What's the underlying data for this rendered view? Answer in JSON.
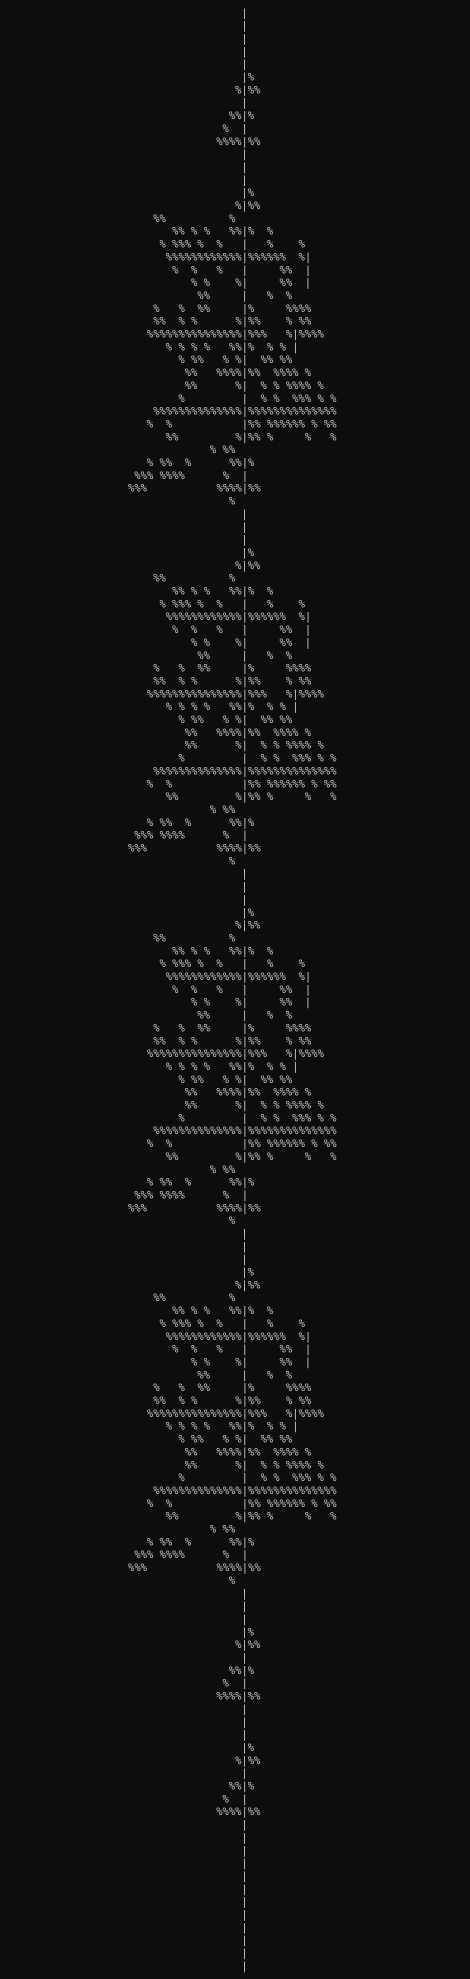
{
  "colors": {
    "background": "#0d0d0d",
    "glyph": "#c8c8c8"
  },
  "canvas": {
    "cols": 76,
    "rows": 168,
    "axis_col": 38
  },
  "art": {
    "glyphs": [
      "%",
      "|"
    ],
    "top_stem_rows": 5,
    "small_block": [
      "|%",
      "%|%%",
      "",
      "%%|%",
      "%  |",
      "%%%%|%%"
    ],
    "big_block": [
      "|%",
      "%|%%",
      "%%          %",
      "%% % %   %%|%  %",
      "% %%% %  %   |   %    %",
      "%%%%%%%%%%%%|%%%%%%  %|",
      "%  %   %   |     %%  |",
      "% %    %|     %%  |",
      "%%     |   %  %",
      "%   %  %%     |%     %%%%",
      "%%  % %      %|%%    % %%",
      "%%%%%%%%%%%%%%%|%%%   %|%%%%",
      "% % % %   %%|%  % % |",
      "% %%   % %|  %% %%",
      "%%   %%%%|%%  %%%% %",
      "%%      %|  % % %%%% %",
      "%         |  % %  %%% % %",
      "%%%%%%%%%%%%%%|%%%%%%%%%%%%%%",
      "%  %           |%% %%%%%% % %%",
      "%%         %|%% %     %   %",
      "% %%",
      "% %%  %      %%|%",
      "%%% %%%%      %  |",
      "%%%           %%%%|%%",
      "%"
    ],
    "sequence": [
      "small",
      "big",
      "big",
      "big",
      "big",
      "small",
      "small"
    ],
    "gap_rows": 3,
    "bottom_stem_rows": 12
  }
}
